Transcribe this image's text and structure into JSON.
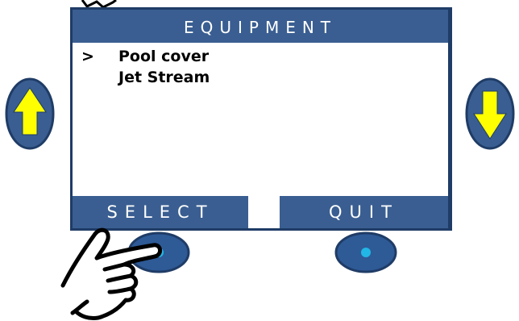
{
  "screen": {
    "title": "EQUIPMENT",
    "menu": [
      {
        "cursor": ">",
        "label": "Pool cover"
      },
      {
        "cursor": "",
        "label": "Jet Stream"
      }
    ],
    "softkeys": {
      "left": "SELECT",
      "right": "QUIT"
    }
  },
  "buttons": {
    "up": "arrow-up-icon",
    "down": "arrow-down-icon",
    "left_hw": "round-button",
    "right_hw": "round-button"
  },
  "colors": {
    "frame": "#1f3c66",
    "bar": "#3a5e91",
    "arrow": "#ffff00",
    "button_dot": "#22b6e6"
  }
}
